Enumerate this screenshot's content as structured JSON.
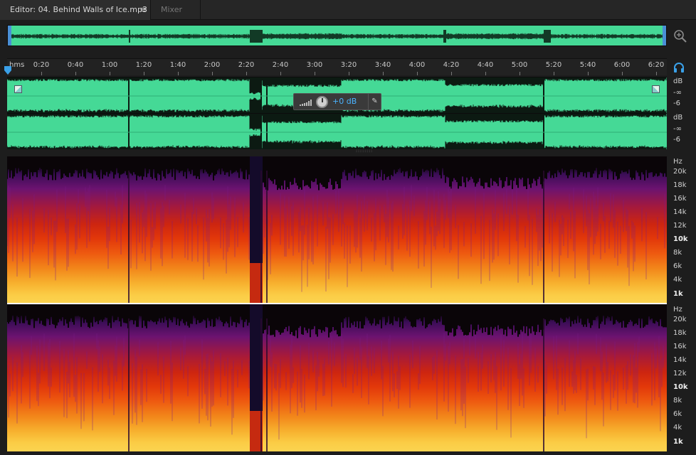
{
  "tabs": {
    "editor_label": "Editor: 04. Behind Walls of Ice.mp3",
    "menu_glyph": "≡",
    "mixer_label": "Mixer"
  },
  "ruler": {
    "unit": "hms",
    "ticks": [
      "0:20",
      "0:40",
      "1:00",
      "1:20",
      "1:40",
      "2:00",
      "2:20",
      "2:40",
      "3:00",
      "3:20",
      "3:40",
      "4:00",
      "4:20",
      "4:40",
      "5:00",
      "5:20",
      "5:40",
      "6:00",
      "6:20"
    ]
  },
  "hud": {
    "value": "+0 dB",
    "pin_glyph": "✎"
  },
  "db_scale": {
    "channel1": [
      "dB",
      "-∞",
      "-6"
    ],
    "channel2": [
      "dB",
      "-∞",
      "-6"
    ]
  },
  "hz_scale": [
    "Hz",
    "20k",
    "18k",
    "16k",
    "14k",
    "12k",
    "10k",
    "8k",
    "6k",
    "4k",
    "1k"
  ],
  "icons": {
    "zoom": "magnifier-zoom-icon",
    "headphones": "headphones-icon",
    "playhead": "playhead-marker-icon",
    "hud_meter": "level-meter-icon",
    "hud_knob": "volume-knob-icon",
    "hud_pin": "pin-icon"
  },
  "colors": {
    "waveform": "#45d996",
    "accent": "#4ab3ff",
    "background": "#1d1d1d"
  }
}
